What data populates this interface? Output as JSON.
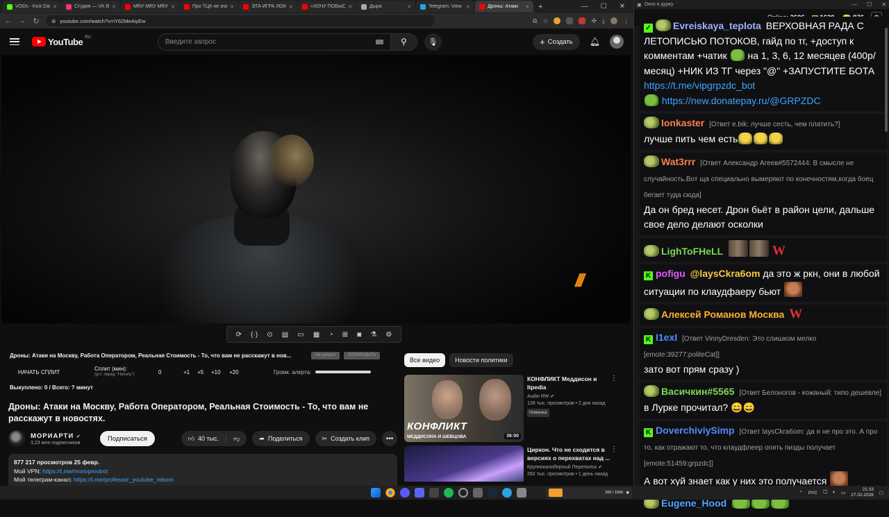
{
  "browser": {
    "tabs": [
      {
        "label": "VODs - Kick Dashb",
        "color": "#53fc18"
      },
      {
        "label": "Студия — VK Видео",
        "color": "#ff3366"
      },
      {
        "label": "MRУ MRУ MRУ M",
        "color": "#ff0000"
      },
      {
        "label": "Про ТЦК не знаю",
        "color": "#ff0000"
      },
      {
        "label": "ЭТА ИГРА ЛОМАЕ",
        "color": "#ff0000"
      },
      {
        "label": "«ХОЧУ ПОБЫСТРЕ",
        "color": "#ff0000"
      },
      {
        "label": "Дыра",
        "color": "#aaaaaa"
      },
      {
        "label": "Telegram: View @",
        "color": "#2aa3df"
      },
      {
        "label": "Дроны: Атаки",
        "color": "#ff0000"
      }
    ],
    "url": "youtube.com/watch?v=iY62MeAiyEw"
  },
  "youtube": {
    "region": "RU",
    "logo_text": "YouTube",
    "search_placeholder": "Введите запрос",
    "create_label": "Создать"
  },
  "player_toolbar": {
    "icons": [
      "loop-icon",
      "audio-icon",
      "camera-icon",
      "film-icon",
      "picture-icon",
      "subtitles-icon",
      "speed-icon",
      "add-icon",
      "screenshot-icon",
      "lab-icon",
      "settings-icon"
    ],
    "glyphs": [
      "⟳",
      "(·)",
      "⊙",
      "▤",
      "▭",
      "▦",
      "◔",
      "⊞",
      "◙",
      "⚗",
      "⚙"
    ]
  },
  "split": {
    "title": "Дроны: Атаки на Москву, Работа Оператором, Реальная Стоимость - То, что вам не расскажут в нов...",
    "btn_start_label": "На начало",
    "btn_copy_label": "КОПИРОВАТЬ",
    "start_split": "НАЧАТЬ СПЛИТ",
    "split_min_label": "Сплит (мин):",
    "split_min_hint": "(уст. перед \"Начать\")",
    "value": "0",
    "increments": [
      "+1",
      "+5",
      "+10",
      "+20"
    ],
    "alert_label": "Громк. алерта:",
    "alert_volume": 1.0,
    "paid": "Выкуплено: 0 / Всего: ? минут"
  },
  "video": {
    "title": "Дроны: Атаки на Москву, Работа Оператором, Реальная Стоимость - То, что вам не расскажут в новостях.",
    "channel": "МОРИАРТИ",
    "subscribers": "3,23 млн подписчиков",
    "subscribe_label": "Подписаться",
    "likes": "40 тыс.",
    "share_label": "Поделиться",
    "clip_label": "Создать клип",
    "description": {
      "stats": "877 217 просмотров  25 февр.",
      "vpn_label": "Мой VPN: ",
      "vpn_link": "https://t.me/morivpnrobot",
      "tg_label": "Мой телеграм-канал: ",
      "tg_link": "https://t.me/professor_youtube_reborn"
    }
  },
  "recommendations": {
    "chips": [
      "Все видео",
      "Новости политики"
    ],
    "items": [
      {
        "title": "КОНФЛИКТ Меддисон и Itpedia",
        "channel": "Audio RW",
        "meta": "128 тыс. просмотров • 2 дня назад",
        "badge": "Новинка",
        "duration": "36:00",
        "thumb_big": "КОНФЛИКТ",
        "thumb_small": "МЕДДИСОНА И ШЕВЦОВА"
      },
      {
        "title": "Циркон. Что не сходится в версиях о перехватах над ...",
        "channel": "Крупнокалиберный Переполох",
        "meta": "282 тыс. просмотров • 1 день назад"
      }
    ]
  },
  "chat": {
    "window_title": "Окно в дурку",
    "online_label": "Online:",
    "online_count": "2606",
    "kick_count": "1630",
    "pepe_count": "976",
    "messages": [
      {
        "user": "Evreiskaya_teplota",
        "color": "#9db1ff",
        "text1": "ВЕРХОВНАЯ РАДА С ЛЕТОПИСЬЮ ПОТОКОВ, гайд по тг, +доступ к комментам +чатик",
        "text2": "на 1, 3, 6, 12 месяцев (400р/месяц) +НИК ИЗ ТГ через \"@\" +ЗАПУСТИТЕ БОТА",
        "link1": "https://t.me/vipgrpzdc_bot",
        "link2": "https://new.donatepay.ru/@GRPZDC"
      },
      {
        "user": "Ionkaster",
        "color": "#ff7f50",
        "reply": "[Ответ e.bik: лучше сесть, чем платить?]",
        "text": "лучше пить чем есть"
      },
      {
        "user": "Wat3rrr",
        "color": "#ff7f50",
        "reply": "[Ответ Александр Агеев#5572444: В смысле не случайность.Вот ща специально вымеряют по конечностям,когда боец бегает туда сюда]",
        "text": "Да он бред несет. Дрон бьёт в район цели, дальше свое дело делают осколки"
      },
      {
        "user": "LighToFHeLL",
        "color": "#7ed957"
      },
      {
        "user": "pofigu",
        "color": "#e05cff",
        "mention": "@laysCkra6om",
        "text": "да это ж ркн, они в любой ситуации по клаудфаеру бьют"
      },
      {
        "user": "Алексей Романов Москва",
        "color": "#ffb02e"
      },
      {
        "user": "I1exI",
        "color": "#4f8cff",
        "reply": "[Ответ VinnyDresden: Это слишком мелко [emote:39277:politeCat]]",
        "text": "зато вот прям сразу )"
      },
      {
        "user": "Васичкин#5565",
        "color": "#7ed957",
        "reply": "[Ответ Белоногов - кожаный: типо дешевле]",
        "text": "в Лурке прочитал?"
      },
      {
        "user": "DoverchiviySimp",
        "color": "#4f8cff",
        "reply": "[Ответ laysCkra6om: да я не про это. А про то, как отражают то, что клаудфлеер опять пизды получает [emote:51459:grpzdc]]",
        "text": "А вот хуй знает как у них это получается"
      },
      {
        "user": "Eugene_Hood",
        "color": "#4fa3ff"
      }
    ]
  },
  "taskbar": {
    "media_text": "200 / 1500",
    "lang": "РУС",
    "time": "21:33",
    "date": "27.02.2026"
  },
  "colors": {
    "accent_red": "#ff0000",
    "kick_green": "#53fc18",
    "link_blue": "#3ea6ff"
  }
}
